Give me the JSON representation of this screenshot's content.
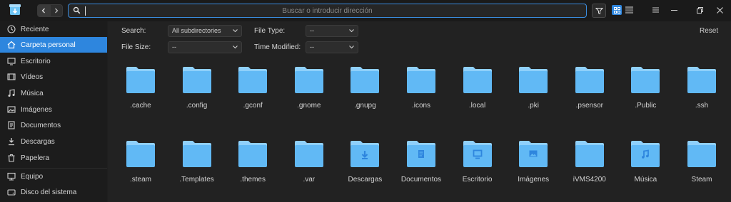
{
  "titlebar": {
    "address_placeholder": "Buscar o introducir dirección"
  },
  "sidebar": {
    "items": [
      {
        "label": "Reciente",
        "icon": "clock-icon"
      },
      {
        "label": "Carpeta personal",
        "icon": "home-icon"
      },
      {
        "label": "Escritorio",
        "icon": "desktop-icon"
      },
      {
        "label": "Vídeos",
        "icon": "video-icon"
      },
      {
        "label": "Música",
        "icon": "music-icon"
      },
      {
        "label": "Imágenes",
        "icon": "image-icon"
      },
      {
        "label": "Documentos",
        "icon": "document-icon"
      },
      {
        "label": "Descargas",
        "icon": "download-icon"
      },
      {
        "label": "Papelera",
        "icon": "trash-icon"
      },
      {
        "label": "Equipo",
        "icon": "computer-icon"
      },
      {
        "label": "Disco del sistema",
        "icon": "disk-icon"
      }
    ],
    "active_index": 1
  },
  "filters": {
    "search_label": "Search:",
    "search_value": "All subdirectories",
    "file_type_label": "File Type:",
    "file_type_value": "--",
    "file_size_label": "File Size:",
    "file_size_value": "--",
    "time_modified_label": "Time Modified:",
    "time_modified_value": "--",
    "reset_label": "Reset"
  },
  "folders_row1": [
    ".cache",
    ".config",
    ".gconf",
    ".gnome",
    ".gnupg",
    ".icons",
    ".local",
    ".pki",
    ".psensor",
    ".Public",
    ".ssh"
  ],
  "folders_row2": [
    {
      "name": ".steam",
      "emblem": ""
    },
    {
      "name": ".Templates",
      "emblem": ""
    },
    {
      "name": ".themes",
      "emblem": ""
    },
    {
      "name": ".var",
      "emblem": ""
    },
    {
      "name": "Descargas",
      "emblem": "download"
    },
    {
      "name": "Documentos",
      "emblem": "document"
    },
    {
      "name": "Escritorio",
      "emblem": "desktop"
    },
    {
      "name": "Imágenes",
      "emblem": "image"
    },
    {
      "name": "iVMS4200",
      "emblem": ""
    },
    {
      "name": "Música",
      "emblem": "music"
    },
    {
      "name": "Steam",
      "emblem": ""
    }
  ],
  "colors": {
    "accent": "#2e86de",
    "folder": "#61b9f5",
    "folder_tab": "#8fd0fb",
    "annotation": "#e8262e"
  }
}
